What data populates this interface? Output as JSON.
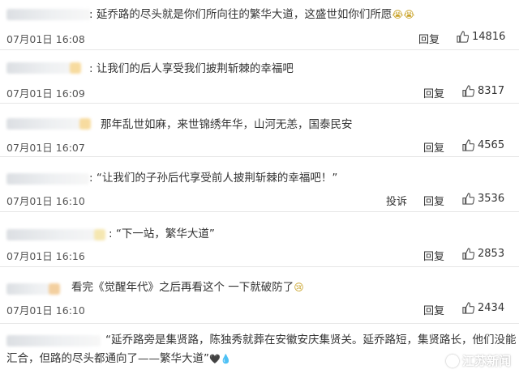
{
  "comments": [
    {
      "text": ": 延乔路的尽头就是你们所向往的繁华大道，这盛世如你们所愿",
      "emojis": "😭😭",
      "time": "07月01日 16:08",
      "reply_label": "回复",
      "likes": "14816"
    },
    {
      "text": ": 让我们的后人享受我们披荆斩棘的幸福吧",
      "time": "07月01日 16:09",
      "reply_label": "回复",
      "likes": "8317"
    },
    {
      "text": "那年乱世如麻，来世锦绣年华，山河无恙，国泰民安",
      "time": "07月01日 16:07",
      "reply_label": "回复",
      "likes": "4565"
    },
    {
      "text": ": “让我们的子孙后代享受前人披荆斩棘的幸福吧！”",
      "time": "07月01日 16:10",
      "report_label": "投诉",
      "reply_label": "回复",
      "likes": "3536"
    },
    {
      "text": ": “下一站，繁华大道”",
      "time": "07月01日 16:16",
      "reply_label": "回复",
      "likes": "2853"
    },
    {
      "text": "看完《觉醒年代》之后再看这个 一下就破防了",
      "emojis": "😢",
      "time": "07月01日 16:10",
      "reply_label": "回复",
      "likes": "2434"
    },
    {
      "text_line1": "“延乔路旁是集贤路，陈独秀就葬在安徽安庆集贤关。延乔路短，集贤路长，他们没能",
      "text_line2": "汇合，但路的尽头都通向了——繁华大道”",
      "emojis": "🖤💧"
    }
  ],
  "watermark": {
    "label": "江苏新闻"
  },
  "colors": {
    "like_icon": "#555555",
    "divider": "#e6e6e6"
  }
}
